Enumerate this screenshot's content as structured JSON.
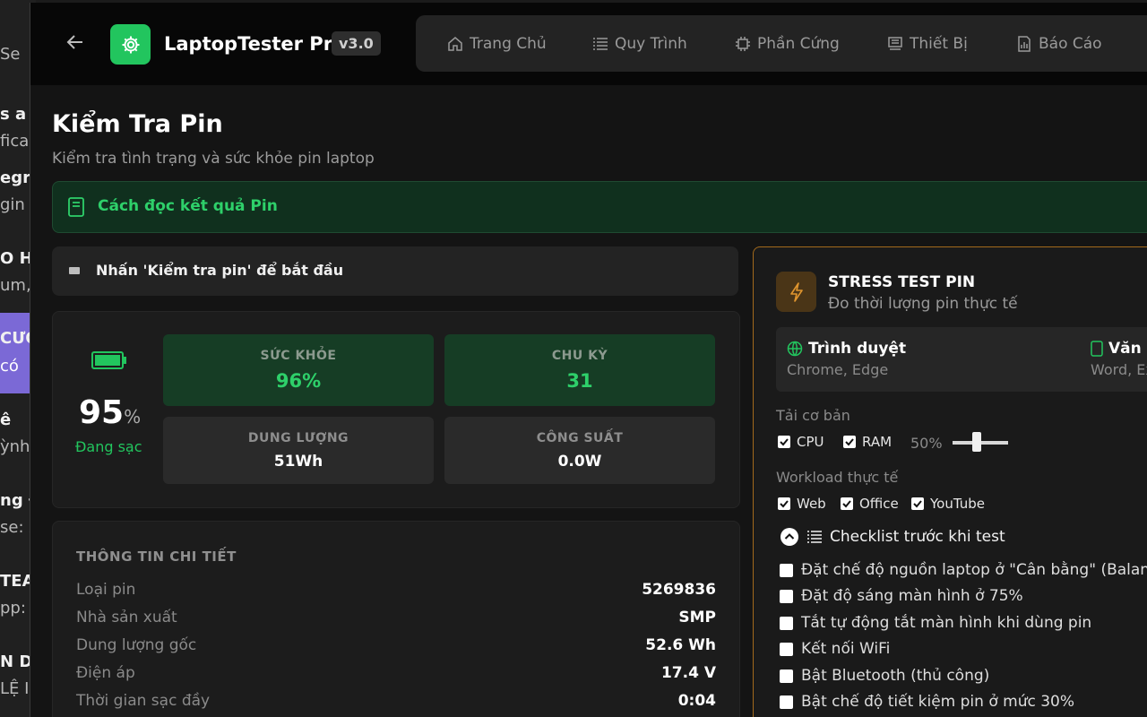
{
  "background_window": {
    "search_label": "Se",
    "lines": [
      {
        "title": "s a n",
        "sub": "fica"
      },
      {
        "title": "egra",
        "sub": "gin c"
      },
      {
        "title": "O Ho",
        "sub": "um,"
      },
      {
        "title": "CƯỜ",
        "sub": "có"
      },
      {
        "title": "ê",
        "sub": "ỳnh"
      },
      {
        "title": "ng Đ",
        "sub": "se: X"
      },
      {
        "title": "TEA",
        "sub": "pp: e"
      },
      {
        "title": "N DI",
        "sub": "LỆ I"
      }
    ]
  },
  "app": {
    "name": "LaptopTester Pro",
    "version": "v3.0",
    "nav": [
      {
        "label": "Trang Chủ",
        "icon": "home-icon"
      },
      {
        "label": "Quy Trình",
        "icon": "list-icon"
      },
      {
        "label": "Phần Cứng",
        "icon": "chip-icon"
      },
      {
        "label": "Thiết Bị",
        "icon": "device-icon"
      },
      {
        "label": "Báo Cáo",
        "icon": "report-icon"
      }
    ]
  },
  "page": {
    "title": "Kiểm Tra Pin",
    "subtitle": "Kiểm tra tình trạng và sức khỏe pin laptop",
    "guide_label": "Cách đọc kết quả Pin",
    "start_hint": "Nhấn 'Kiểm tra pin' để bắt đầu"
  },
  "battery": {
    "percent": "95",
    "percent_unit": "%",
    "status": "Đang sạc",
    "stats": {
      "health_label": "SỨC KHỎE",
      "health_value": "96%",
      "cycles_label": "CHU KỲ",
      "cycles_value": "31",
      "capacity_label": "DUNG LƯỢNG",
      "capacity_value": "51Wh",
      "power_label": "CÔNG SUẤT",
      "power_value": "0.0W"
    }
  },
  "details": {
    "heading": "THÔNG TIN CHI TIẾT",
    "rows": [
      {
        "key": "Loại pin",
        "value": "5269836"
      },
      {
        "key": "Nhà sản xuất",
        "value": "SMP"
      },
      {
        "key": "Dung lượng gốc",
        "value": "52.6 Wh"
      },
      {
        "key": "Điện áp",
        "value": "17.4 V"
      },
      {
        "key": "Thời gian sạc đầy",
        "value": "0:04"
      }
    ]
  },
  "stress": {
    "title": "STRESS TEST PIN",
    "subtitle": "Đo thời lượng pin thực tế",
    "modes": [
      {
        "title": "Trình duyệt",
        "sub": "Chrome, Edge"
      },
      {
        "title": "Văn p",
        "sub": "Word, Ex"
      }
    ],
    "base_load_label": "Tải cơ bản",
    "base_load": [
      {
        "label": "CPU",
        "checked": true
      },
      {
        "label": "RAM",
        "checked": true
      }
    ],
    "load_percent": "50%",
    "workload_label": "Workload thực tế",
    "workload": [
      {
        "label": "Web",
        "checked": true
      },
      {
        "label": "Office",
        "checked": true
      },
      {
        "label": "YouTube",
        "checked": true
      }
    ],
    "checklist_title": "Checklist trước khi test",
    "checklist": [
      "Đặt chế độ nguồn laptop ở \"Cân bằng\" (Balance)",
      "Đặt độ sáng màn hình ở 75%",
      "Tắt tự động tắt màn hình khi dùng pin",
      "Kết nối WiFi",
      "Bật Bluetooth (thủ công)",
      "Bật chế độ tiết kiệm pin ở mức 30%"
    ]
  },
  "colors": {
    "accent_green": "#22c55e",
    "stress_border": "#a36a1c"
  }
}
